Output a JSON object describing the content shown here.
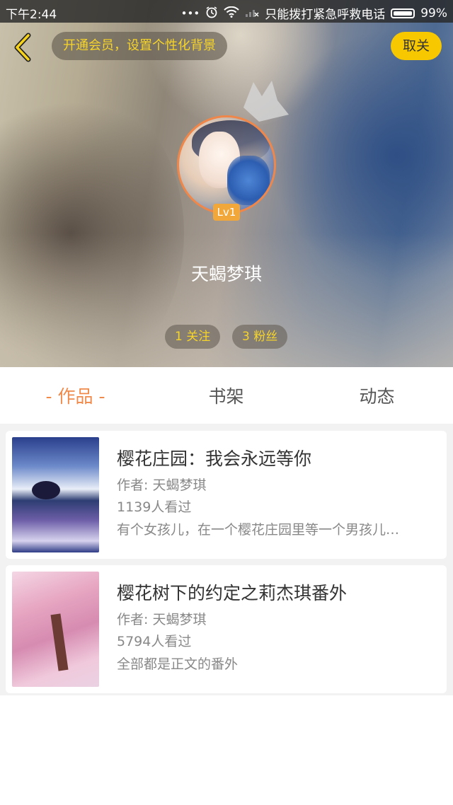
{
  "status_bar": {
    "time": "下午2:44",
    "dots": "•••",
    "carrier": "只能拨打紧急呼救电话",
    "battery": "99%"
  },
  "header": {
    "vip_prompt": "开通会员，设置个性化背景",
    "close_label": "取关"
  },
  "profile": {
    "level": "Lv1",
    "nickname": "天蝎梦琪",
    "following": "1 关注",
    "followers": "3 粉丝"
  },
  "tabs": [
    {
      "label": "- 作品 -",
      "active": true
    },
    {
      "label": "书架",
      "active": false
    },
    {
      "label": "动态",
      "active": false
    }
  ],
  "works": [
    {
      "title": "樱花庄园：我会永远等你",
      "author": "作者: 天蝎梦琪",
      "views": "1139人看过",
      "summary": "有个女孩儿，在一个樱花庄园里等一个男孩儿…"
    },
    {
      "title": "樱花树下的约定之莉杰琪番外",
      "author": "作者: 天蝎梦琪",
      "views": "5794人看过",
      "summary": "全部都是正文的番外"
    }
  ],
  "colors": {
    "accent": "#f08a4b",
    "yellow": "#f7c800",
    "stat_text": "#f6d42a"
  }
}
